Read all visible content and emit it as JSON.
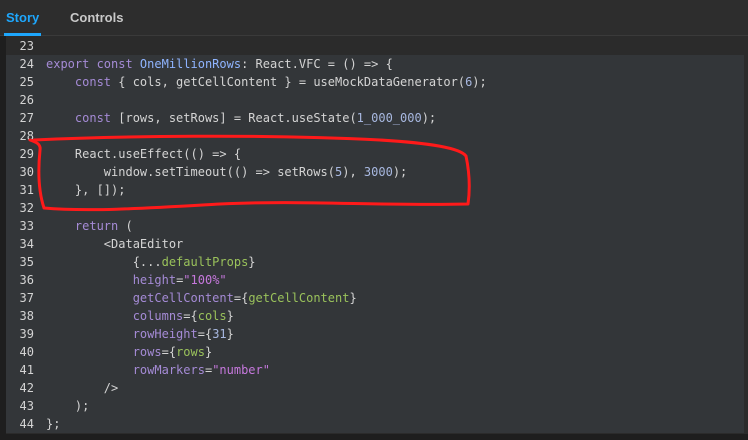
{
  "tabs": {
    "story": "Story",
    "controls": "Controls"
  },
  "code": {
    "lines": [
      {
        "n": "23",
        "t": []
      },
      {
        "n": "24",
        "t": [
          [
            "kw",
            "export const "
          ],
          [
            "fn",
            "OneMillionRows"
          ],
          [
            "p",
            ": React.VFC = () => {"
          ]
        ]
      },
      {
        "n": "25",
        "t": [
          [
            "p",
            "    "
          ],
          [
            "kw",
            "const"
          ],
          [
            "p",
            " { cols, getCellContent } = "
          ],
          [
            "p",
            "useMockDataGenerator"
          ],
          [
            "p",
            "("
          ],
          [
            "num",
            "6"
          ],
          [
            "p",
            ");"
          ]
        ]
      },
      {
        "n": "26",
        "t": []
      },
      {
        "n": "27",
        "t": [
          [
            "p",
            "    "
          ],
          [
            "kw",
            "const"
          ],
          [
            "p",
            " [rows, setRows] = React.useState("
          ],
          [
            "num",
            "1_000_000"
          ],
          [
            "p",
            ");"
          ]
        ]
      },
      {
        "n": "28",
        "t": []
      },
      {
        "n": "29",
        "t": [
          [
            "p",
            "    React.useEffect(() => {"
          ]
        ]
      },
      {
        "n": "30",
        "t": [
          [
            "p",
            "        window.setTimeout(() => setRows("
          ],
          [
            "num",
            "5"
          ],
          [
            "p",
            "), "
          ],
          [
            "num",
            "3000"
          ],
          [
            "p",
            ");"
          ]
        ]
      },
      {
        "n": "31",
        "t": [
          [
            "p",
            "    }, []);"
          ]
        ]
      },
      {
        "n": "32",
        "t": []
      },
      {
        "n": "33",
        "t": [
          [
            "p",
            "    "
          ],
          [
            "kw",
            "return"
          ],
          [
            "p",
            " ("
          ]
        ]
      },
      {
        "n": "34",
        "t": [
          [
            "p",
            "        <DataEditor"
          ]
        ]
      },
      {
        "n": "35",
        "t": [
          [
            "p",
            "            {..."
          ],
          [
            "val",
            "defaultProps"
          ],
          [
            "p",
            "}"
          ]
        ]
      },
      {
        "n": "36",
        "t": [
          [
            "p",
            "            "
          ],
          [
            "attr",
            "height"
          ],
          [
            "p",
            "="
          ],
          [
            "str",
            "\"100%\""
          ]
        ]
      },
      {
        "n": "37",
        "t": [
          [
            "p",
            "            "
          ],
          [
            "attr",
            "getCellContent"
          ],
          [
            "p",
            "={"
          ],
          [
            "val",
            "getCellContent"
          ],
          [
            "p",
            "}"
          ]
        ]
      },
      {
        "n": "38",
        "t": [
          [
            "p",
            "            "
          ],
          [
            "attr",
            "columns"
          ],
          [
            "p",
            "={"
          ],
          [
            "val",
            "cols"
          ],
          [
            "p",
            "}"
          ]
        ]
      },
      {
        "n": "39",
        "t": [
          [
            "p",
            "            "
          ],
          [
            "attr",
            "rowHeight"
          ],
          [
            "p",
            "={"
          ],
          [
            "num",
            "31"
          ],
          [
            "p",
            "}"
          ]
        ]
      },
      {
        "n": "40",
        "t": [
          [
            "p",
            "            "
          ],
          [
            "attr",
            "rows"
          ],
          [
            "p",
            "={"
          ],
          [
            "val",
            "rows"
          ],
          [
            "p",
            "}"
          ]
        ]
      },
      {
        "n": "41",
        "t": [
          [
            "p",
            "            "
          ],
          [
            "attr",
            "rowMarkers"
          ],
          [
            "p",
            "="
          ],
          [
            "str",
            "\"number\""
          ]
        ]
      },
      {
        "n": "42",
        "t": [
          [
            "p",
            "        />"
          ]
        ]
      },
      {
        "n": "43",
        "t": [
          [
            "p",
            "    );"
          ]
        ]
      },
      {
        "n": "44",
        "t": [
          [
            "p",
            "};"
          ]
        ]
      }
    ],
    "highlighted_range": [
      "24",
      "44"
    ]
  },
  "colors": {
    "accent": "#1ea7fd",
    "annotation": "#ff1a1a",
    "background": "#2b2b2b"
  },
  "annotation": {
    "type": "hand-drawn-red-outline",
    "encloses_lines": [
      "29",
      "30",
      "31"
    ]
  }
}
